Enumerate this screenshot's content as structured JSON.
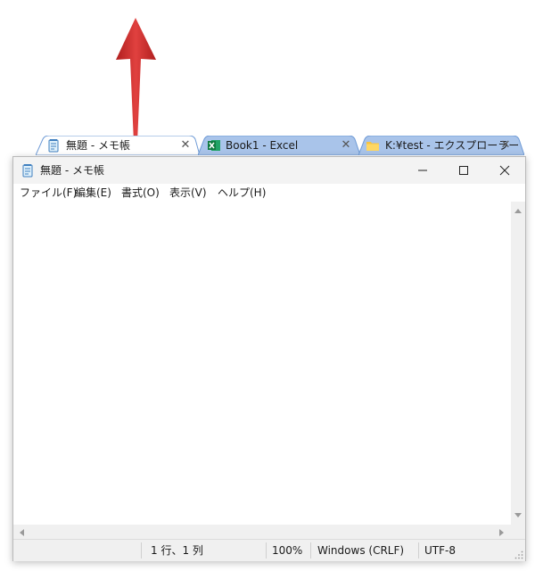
{
  "tabs": [
    {
      "label": "無題 - メモ帳",
      "icon": "notepad-icon",
      "close": "✕",
      "active": true
    },
    {
      "label": "Book1 - Excel",
      "icon": "excel-icon",
      "close": "✕",
      "active": false
    },
    {
      "label": "K:¥test - エクスプローラー",
      "icon": "folder-icon",
      "close": "✕",
      "active": false
    }
  ],
  "window": {
    "title": "無題 - メモ帳",
    "icon": "notepad-icon"
  },
  "menu": [
    "ファイル(F)",
    "編集(E)",
    "書式(O)",
    "表示(V)",
    "ヘルプ(H)"
  ],
  "editor": {
    "content": ""
  },
  "status": {
    "position": "1 行、1 列",
    "zoom": "100%",
    "line_ending": "Windows (CRLF)",
    "encoding": "UTF-8"
  },
  "colors": {
    "active_tab": "#ffffff",
    "inactive_tab": "#a9c4ea",
    "tab_border": "#6f9bd6",
    "arrow": "#cc2a2a"
  }
}
